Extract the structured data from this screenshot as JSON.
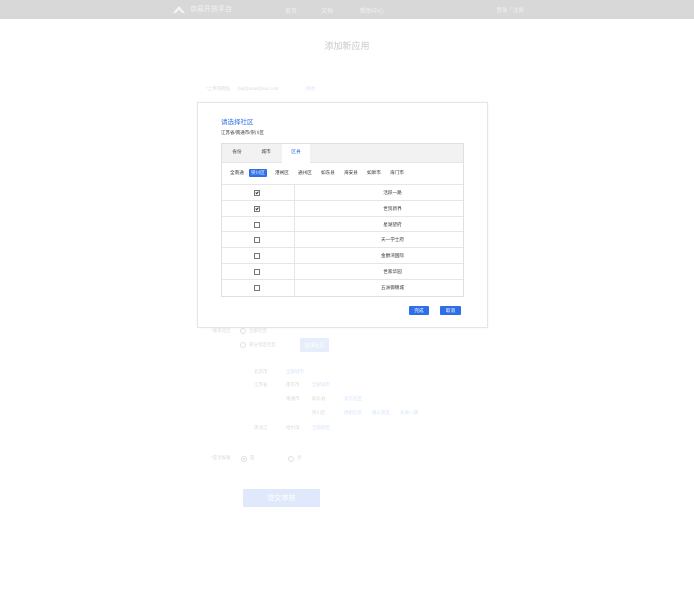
{
  "nav": {
    "logo_text": "京易开放平台",
    "items": [
      "首页",
      "文档",
      "帮助中心"
    ],
    "login": "登录",
    "separator": "|",
    "register": "注册"
  },
  "page_title": "添加新应用",
  "form": {
    "email_label": "*上传内网址",
    "email_value": "bat@xdut@sxx.com",
    "email_action": "修改",
    "community_label": "*联系社区",
    "option_all": "全部社区",
    "option_partial": "部分指定社区",
    "select_button": "选择社区",
    "tree": {
      "rows": [
        {
          "province": "北京市",
          "city": "",
          "district": "",
          "items": [
            "全部城市"
          ]
        },
        {
          "province": "江苏省",
          "city": "南京市",
          "district": "",
          "items": [
            "全部城市"
          ]
        },
        {
          "province": "",
          "city": "南通市",
          "district": "如东县",
          "items": [
            "龙信社区"
          ]
        },
        {
          "province": "",
          "city": "",
          "district": "崇川区",
          "items": [
            "佛祖社区",
            "狼山景区",
            "天目一期"
          ]
        },
        {
          "province": "黑龙江",
          "city": "哈尔滨",
          "district": "",
          "items": [
            "全部街区"
          ]
        }
      ]
    },
    "notify_label": "*是否报备",
    "yes": "是",
    "no": "否",
    "submit": "提交审核"
  },
  "modal": {
    "title": "请选择社区",
    "path": "江苏省/南通市/崇川区",
    "tabs": [
      {
        "label": "省份",
        "active": false
      },
      {
        "label": "城市",
        "active": false
      },
      {
        "label": "区县",
        "active": true
      }
    ],
    "districts": [
      {
        "label": "全南通",
        "active": false
      },
      {
        "label": "崇川区",
        "active": true
      },
      {
        "label": "港闸区",
        "active": false
      },
      {
        "label": "通州区",
        "active": false
      },
      {
        "label": "如东县",
        "active": false
      },
      {
        "label": "海安县",
        "active": false
      },
      {
        "label": "如皋市",
        "active": false
      },
      {
        "label": "海门市",
        "active": false
      }
    ],
    "communities": [
      {
        "name": "活跃一路",
        "checked": true
      },
      {
        "name": "世贸新界",
        "checked": true
      },
      {
        "name": "星湖望府",
        "checked": false
      },
      {
        "name": "天一学士府",
        "checked": false
      },
      {
        "name": "金爵湾国际",
        "checked": false
      },
      {
        "name": "世家华园",
        "checked": false
      },
      {
        "name": "五洲御锦城",
        "checked": false
      }
    ],
    "done_button": "完成",
    "cancel_button": "取消"
  },
  "colors": {
    "accent": "#2e6fe8",
    "topbar": "#d8d8d8"
  }
}
